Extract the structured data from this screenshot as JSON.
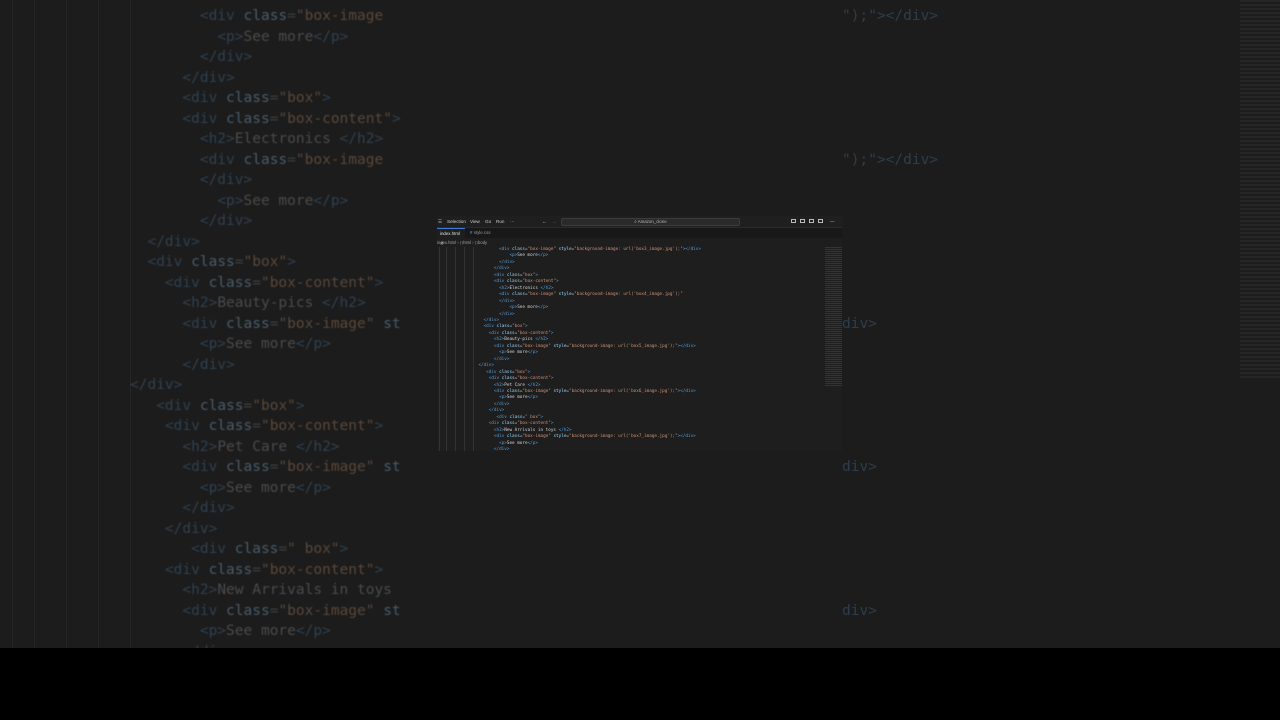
{
  "titlebar": {
    "menu": [
      "Selection",
      "View",
      "Go",
      "Run",
      "···"
    ],
    "search_label": "Amazon_clone",
    "icons": [
      "layout-sidebar-icon",
      "layout-panel-icon",
      "layout-secondary-icon",
      "customize-layout-icon"
    ]
  },
  "tabs": [
    {
      "label": "index.html",
      "active": true
    },
    {
      "label": "style.css",
      "active": false
    }
  ],
  "breadcrumb": [
    "index.html",
    "html",
    "body"
  ],
  "code_lines": [
    {
      "indent": 16,
      "html": "<span class='tg'>&lt;div</span> <span class='at'>class</span>=<span class='st'>\"box-image\"</span> <span class='at'>style</span>=<span class='st'>\"background-image: url('box3_image.jpg');\"</span><span class='tg'>&gt;&lt;/div&gt;</span>"
    },
    {
      "indent": 20,
      "html": "<span class='tg'>&lt;p&gt;</span><span class='tx'>See more</span><span class='tg'>&lt;/p&gt;</span>"
    },
    {
      "indent": 16,
      "html": "<span class='tg'>&lt;/div&gt;</span>"
    },
    {
      "indent": 14,
      "html": "<span class='tg'>&lt;/div&gt;</span>"
    },
    {
      "indent": 14,
      "html": "<span class='tg'>&lt;div</span> <span class='at'>class</span>=<span class='st'>\"box\"</span><span class='tg'>&gt;</span>"
    },
    {
      "indent": 14,
      "html": "<span class='tg'>&lt;div</span> <span class='at'>class</span>=<span class='st'>\"box-content\"</span><span class='tg'>&gt;</span>"
    },
    {
      "indent": 16,
      "html": "<span class='tg'>&lt;h2&gt;</span><span class='tx'>Electronics </span><span class='tg'>&lt;/h2&gt;</span>"
    },
    {
      "indent": 16,
      "html": "<span class='tg'>&lt;div</span> <span class='at'>class</span>=<span class='st'>\"box-image\"</span> <span class='at'>style</span>=<span class='st'>\"background-image: url('box4_image.jpg');\"</span>"
    },
    {
      "indent": 16,
      "html": "<span class='tg'>&lt;/div&gt;</span>"
    },
    {
      "indent": 20,
      "html": "<span class='tg'>&lt;p&gt;</span><span class='tx'>See more</span><span class='tg'>&lt;/p&gt;</span>"
    },
    {
      "indent": 16,
      "html": "<span class='tg'>&lt;/div&gt;</span>"
    },
    {
      "indent": 10,
      "html": "<span class='tg'>&lt;/div&gt;</span>"
    },
    {
      "indent": 10,
      "html": "<span class='tg'>&lt;div</span> <span class='at'>class</span>=<span class='st'>\"box\"</span><span class='tg'>&gt;</span>"
    },
    {
      "indent": 12,
      "html": "<span class='tg'>&lt;div</span> <span class='at'>class</span>=<span class='st'>\"box-content\"</span><span class='tg'>&gt;</span>"
    },
    {
      "indent": 14,
      "html": "<span class='tg'>&lt;h2&gt;</span><span class='tx'>Beauty-pics </span><span class='tg'>&lt;/h2&gt;</span>"
    },
    {
      "indent": 14,
      "html": "<span class='tg'>&lt;div</span> <span class='at'>class</span>=<span class='st'>\"box-image\"</span> <span class='at'>style</span>=<span class='st'>\"background-image: url('box5_image.jpg');\"</span><span class='tg'>&gt;&lt;/div&gt;</span>"
    },
    {
      "indent": 16,
      "html": "<span class='tg'>&lt;p&gt;</span><span class='tx'>See more</span><span class='tg'>&lt;/p&gt;</span>"
    },
    {
      "indent": 14,
      "html": "<span class='tg'>&lt;/div&gt;</span>"
    },
    {
      "indent": 8,
      "html": "<span class='tg'>&lt;/div&gt;</span>"
    },
    {
      "indent": 11,
      "html": "<span class='tg'>&lt;div</span> <span class='at'>class</span>=<span class='st'>\"box\"</span><span class='tg'>&gt;</span>"
    },
    {
      "indent": 12,
      "html": "<span class='tg'>&lt;div</span> <span class='at'>class</span>=<span class='st'>\"box-content\"</span><span class='tg'>&gt;</span>"
    },
    {
      "indent": 14,
      "html": "<span class='tg'>&lt;h2&gt;</span><span class='tx'>Pet Care </span><span class='tg'>&lt;/h2&gt;</span>"
    },
    {
      "indent": 14,
      "html": "<span class='tg'>&lt;div</span> <span class='at'>class</span>=<span class='st'>\"box-image\"</span> <span class='at'>style</span>=<span class='st'>\"background-image: url('box6_image.jpg');\"</span><span class='tg'>&gt;&lt;/div&gt;</span>"
    },
    {
      "indent": 16,
      "html": "<span class='tg'>&lt;p&gt;</span><span class='tx'>See more</span><span class='tg'>&lt;/p&gt;</span>"
    },
    {
      "indent": 14,
      "html": "<span class='tg'>&lt;/div&gt;</span>"
    },
    {
      "indent": 12,
      "html": "<span class='tg'>&lt;/div&gt;</span>"
    },
    {
      "indent": 15,
      "html": "<span class='tg'>&lt;div</span> <span class='at'>class</span>=<span class='st'>\" box\"</span><span class='tg'>&gt;</span>"
    },
    {
      "indent": 12,
      "html": "<span class='tg'>&lt;div</span> <span class='at'>class</span>=<span class='st'>\"box-content\"</span><span class='tg'>&gt;</span>"
    },
    {
      "indent": 14,
      "html": "<span class='tg'>&lt;h2&gt;</span><span class='tx'>New Arrivals in toys </span><span class='tg'>&lt;/h2&gt;</span>"
    },
    {
      "indent": 14,
      "html": "<span class='tg'>&lt;div</span> <span class='at'>class</span>=<span class='st'>\"box-image\"</span> <span class='at'>style</span>=<span class='st'>\"background-image: url('box7_image.jpg');\"</span><span class='tg'>&gt;&lt;/div&gt;</span>"
    },
    {
      "indent": 16,
      "html": "<span class='tg'>&lt;p&gt;</span><span class='tx'>See more</span><span class='tg'>&lt;/p&gt;</span>"
    },
    {
      "indent": 14,
      "html": "<span class='tg'>&lt;/div&gt;</span>"
    }
  ],
  "background_code": [
    {
      "indent": 8,
      "html": "<span class='tg'>&lt;div</span> <span class='at'>class</span>=<span class='st'>\"box-image</span>"
    },
    {
      "indent": 10,
      "html": "<span class='tg'>&lt;p&gt;</span><span class='tx'>See more</span><span class='tg'>&lt;/p&gt;</span>"
    },
    {
      "indent": 8,
      "html": "<span class='tg'>&lt;/div&gt;</span>"
    },
    {
      "indent": 6,
      "html": "<span class='tg'>&lt;/div&gt;</span>"
    },
    {
      "indent": 6,
      "html": "<span class='tg'>&lt;div</span> <span class='at'>class</span>=<span class='st'>\"box\"</span><span class='tg'>&gt;</span>"
    },
    {
      "indent": 6,
      "html": "<span class='tg'>&lt;div</span> <span class='at'>class</span>=<span class='st'>\"box-content\"</span><span class='tg'>&gt;</span>"
    },
    {
      "indent": 8,
      "html": "<span class='tg'>&lt;h2&gt;</span><span class='tx'>Electronics </span><span class='tg'>&lt;/h2&gt;</span>"
    },
    {
      "indent": 8,
      "html": "<span class='tg'>&lt;div</span> <span class='at'>class</span>=<span class='st'>\"box-image</span>"
    },
    {
      "indent": 8,
      "html": "<span class='tg'>&lt;/div&gt;</span>"
    },
    {
      "indent": 10,
      "html": "<span class='tg'>&lt;p&gt;</span><span class='tx'>See more</span><span class='tg'>&lt;/p&gt;</span>"
    },
    {
      "indent": 8,
      "html": "<span class='tg'>&lt;/div&gt;</span>"
    },
    {
      "indent": 2,
      "html": "<span class='tg'>&lt;/div&gt;</span>"
    },
    {
      "indent": 2,
      "html": "<span class='tg'>&lt;div</span> <span class='at'>class</span>=<span class='st'>\"box\"</span><span class='tg'>&gt;</span>"
    },
    {
      "indent": 4,
      "html": "<span class='tg'>&lt;div</span> <span class='at'>class</span>=<span class='st'>\"box-content\"</span><span class='tg'>&gt;</span>"
    },
    {
      "indent": 6,
      "html": "<span class='tg'>&lt;h2&gt;</span><span class='tx'>Beauty-pics </span><span class='tg'>&lt;/h2&gt;</span>"
    },
    {
      "indent": 6,
      "html": "<span class='tg'>&lt;div</span> <span class='at'>class</span>=<span class='st'>\"box-image\"</span> <span class='at'>st</span>"
    },
    {
      "indent": 8,
      "html": "<span class='tg'>&lt;p&gt;</span><span class='tx'>See more</span><span class='tg'>&lt;/p&gt;</span>"
    },
    {
      "indent": 6,
      "html": "<span class='tg'>&lt;/div&gt;</span>"
    },
    {
      "indent": 0,
      "html": "<span class='tg'>&lt;/div&gt;</span>"
    },
    {
      "indent": 3,
      "html": "<span class='tg'>&lt;div</span> <span class='at'>class</span>=<span class='st'>\"box\"</span><span class='tg'>&gt;</span>"
    },
    {
      "indent": 4,
      "html": "<span class='tg'>&lt;div</span> <span class='at'>class</span>=<span class='st'>\"box-content\"</span><span class='tg'>&gt;</span>"
    },
    {
      "indent": 6,
      "html": "<span class='tg'>&lt;h2&gt;</span><span class='tx'>Pet Care </span><span class='tg'>&lt;/h2&gt;</span>"
    },
    {
      "indent": 6,
      "html": "<span class='tg'>&lt;div</span> <span class='at'>class</span>=<span class='st'>\"box-image\"</span> <span class='at'>st</span>"
    },
    {
      "indent": 8,
      "html": "<span class='tg'>&lt;p&gt;</span><span class='tx'>See more</span><span class='tg'>&lt;/p&gt;</span>"
    },
    {
      "indent": 6,
      "html": "<span class='tg'>&lt;/div&gt;</span>"
    },
    {
      "indent": 4,
      "html": "<span class='tg'>&lt;/div&gt;</span>"
    },
    {
      "indent": 7,
      "html": "<span class='tg'>&lt;div</span> <span class='at'>class</span>=<span class='st'>\" box\"</span><span class='tg'>&gt;</span>"
    },
    {
      "indent": 4,
      "html": "<span class='tg'>&lt;div</span> <span class='at'>class</span>=<span class='st'>\"box-content\"</span><span class='tg'>&gt;</span>"
    },
    {
      "indent": 6,
      "html": "<span class='tg'>&lt;h2&gt;</span><span class='tx'>New Arrivals in toys</span>"
    },
    {
      "indent": 6,
      "html": "<span class='tg'>&lt;div</span> <span class='at'>class</span>=<span class='st'>\"box-image\"</span> <span class='at'>st</span>"
    },
    {
      "indent": 8,
      "html": "<span class='tg'>&lt;p&gt;</span><span class='tx'>See more</span><span class='tg'>&lt;/p&gt;</span>"
    },
    {
      "indent": 6,
      "html": "<span class='tg'>&lt;/div&gt;</span>"
    }
  ],
  "background_right_code": [
    {
      "line": 0,
      "text": "\");\"></div>"
    },
    {
      "line": 7,
      "text": "\");\"></div>"
    },
    {
      "line": 15,
      "text": "div>"
    },
    {
      "line": 22,
      "text": "div>"
    },
    {
      "line": 29,
      "text": "div>"
    }
  ],
  "colors": {
    "tag": "#569cd6",
    "attribute": "#9cdcfe",
    "string": "#ce9178",
    "text": "#d4d4d4",
    "editor_bg": "#1e1e1e",
    "active_tab_accent": "#3a7bd5"
  }
}
